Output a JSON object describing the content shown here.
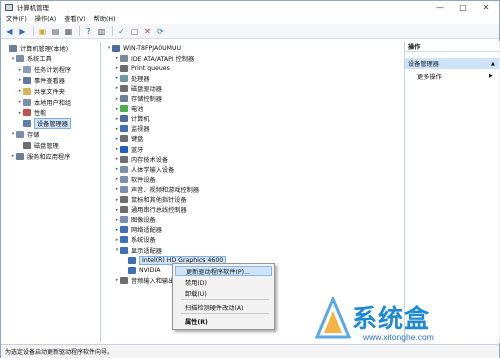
{
  "window": {
    "title": "计算机管理",
    "minimize": "—",
    "restore": "□",
    "close": "✕"
  },
  "menu": [
    "文件(F)",
    "操作(A)",
    "查看(V)",
    "帮助(H)"
  ],
  "left_tree": [
    {
      "label": "计算机管理(本地)",
      "level": 0,
      "exp": "",
      "icon": "#6b7f99"
    },
    {
      "label": "系统工具",
      "level": 1,
      "exp": "▾",
      "icon": "#7c8ea7"
    },
    {
      "label": "任务计划程序",
      "level": 2,
      "exp": "▸",
      "icon": "#8a9db6"
    },
    {
      "label": "事件查看器",
      "level": 2,
      "exp": "▸",
      "icon": "#5e7aa3"
    },
    {
      "label": "共享文件夹",
      "level": 2,
      "exp": "▸",
      "icon": "#d9b45a"
    },
    {
      "label": "本地用户和组",
      "level": 2,
      "exp": "▸",
      "icon": "#7a8fb0"
    },
    {
      "label": "性能",
      "level": 2,
      "exp": "▸",
      "icon": "#c0504d"
    },
    {
      "label": "设备管理器",
      "level": 2,
      "exp": "",
      "icon": "#5d7fb0",
      "selected": true
    },
    {
      "label": "存储",
      "level": 1,
      "exp": "▾",
      "icon": "#7c8ea7"
    },
    {
      "label": "磁盘管理",
      "level": 2,
      "exp": "",
      "icon": "#6d6d6d"
    },
    {
      "label": "服务和应用程序",
      "level": 1,
      "exp": "▸",
      "icon": "#6b7f99"
    }
  ],
  "device_tree": [
    {
      "label": "WIN-T8FPJA0UMUU",
      "level": 0,
      "exp": "▾",
      "icon": "#4d6e9c"
    },
    {
      "label": "IDE ATA/ATAPI 控制器",
      "level": 1,
      "exp": "▸",
      "icon": "#7d8a99"
    },
    {
      "label": "Print queues",
      "level": 1,
      "exp": "▸",
      "icon": "#6d6d6d"
    },
    {
      "label": "处理器",
      "level": 1,
      "exp": "▸",
      "icon": "#6a9aa0"
    },
    {
      "label": "磁盘驱动器",
      "level": 1,
      "exp": "▸",
      "icon": "#6d6d6d"
    },
    {
      "label": "存储控制器",
      "level": 1,
      "exp": "▸",
      "icon": "#6b7f99"
    },
    {
      "label": "电池",
      "level": 1,
      "exp": "▸",
      "icon": "#4caf50"
    },
    {
      "label": "计算机",
      "level": 1,
      "exp": "▸",
      "icon": "#4d6e9c"
    },
    {
      "label": "监视器",
      "level": 1,
      "exp": "▸",
      "icon": "#3f6fb5"
    },
    {
      "label": "键盘",
      "level": 1,
      "exp": "▸",
      "icon": "#6d6d6d"
    },
    {
      "label": "蓝牙",
      "level": 1,
      "exp": "▸",
      "icon": "#1f5fbf"
    },
    {
      "label": "内存技术设备",
      "level": 1,
      "exp": "▸",
      "icon": "#6d6d6d"
    },
    {
      "label": "人体学输入设备",
      "level": 1,
      "exp": "▸",
      "icon": "#7a8fb0"
    },
    {
      "label": "软件设备",
      "level": 1,
      "exp": "▸",
      "icon": "#7a8fb0"
    },
    {
      "label": "声音、视频和游戏控制器",
      "level": 1,
      "exp": "▸",
      "icon": "#7a8fb0"
    },
    {
      "label": "鼠标和其他指针设备",
      "level": 1,
      "exp": "▸",
      "icon": "#6d6d6d"
    },
    {
      "label": "通用串行总线控制器",
      "level": 1,
      "exp": "▸",
      "icon": "#6d6d6d"
    },
    {
      "label": "图像设备",
      "level": 1,
      "exp": "▸",
      "icon": "#7a8fb0"
    },
    {
      "label": "网络适配器",
      "level": 1,
      "exp": "▸",
      "icon": "#3f6fb5"
    },
    {
      "label": "系统设备",
      "level": 1,
      "exp": "▸",
      "icon": "#3f6fb5"
    },
    {
      "label": "显示适配器",
      "level": 1,
      "exp": "▾",
      "icon": "#3f6fb5"
    },
    {
      "label": "Intel(R) HD Graphics 4600",
      "level": 2,
      "exp": "",
      "icon": "#3f6fb5",
      "selected": true
    },
    {
      "label": "NVIDIA",
      "level": 2,
      "exp": "",
      "icon": "#3f6fb5"
    },
    {
      "label": "音频输入和输出",
      "level": 1,
      "exp": "▸",
      "icon": "#6d6d6d"
    }
  ],
  "context_menu": [
    "更新驱动程序软件(P)...",
    "禁用(D)",
    "卸载(U)",
    "扫描检测硬件改动(A)",
    "属性(R)"
  ],
  "actions": {
    "title": "操作",
    "section": "设备管理器",
    "more": "更多操作"
  },
  "status": "为选定设备启动更新驱动程序软件向导。",
  "watermark": {
    "brand": "系统盒",
    "url": "www.xitonghe.com"
  }
}
